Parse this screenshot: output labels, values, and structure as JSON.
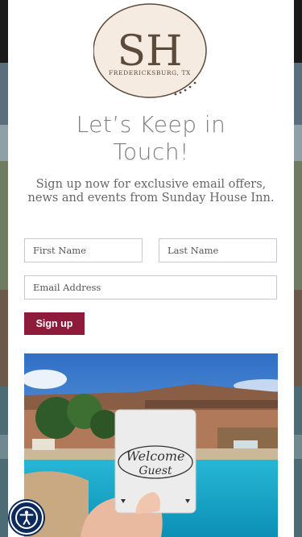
{
  "logo": {
    "monogram": "SH",
    "location": "FREDERICKSBURG, TX"
  },
  "modal": {
    "headline": "Let’s Keep in Touch!",
    "subtext": "Sign up now for exclusive email offers, news and events from Sunday House Inn.",
    "fields": {
      "first_name_placeholder": "First Name",
      "last_name_placeholder": "Last Name",
      "email_placeholder": "Email Address"
    },
    "signup_label": "Sign up",
    "photo": {
      "card_text_line1": "Welcome",
      "card_text_line2": "Guest"
    }
  },
  "colors": {
    "accent": "#8e1b3a",
    "headline": "#7d7d7d",
    "logo_circle": "#f5ebe0",
    "logo_text": "#5c4a3a",
    "a11y_button": "#0d2a5c"
  },
  "icons": {
    "accessibility": "accessibility-icon"
  }
}
